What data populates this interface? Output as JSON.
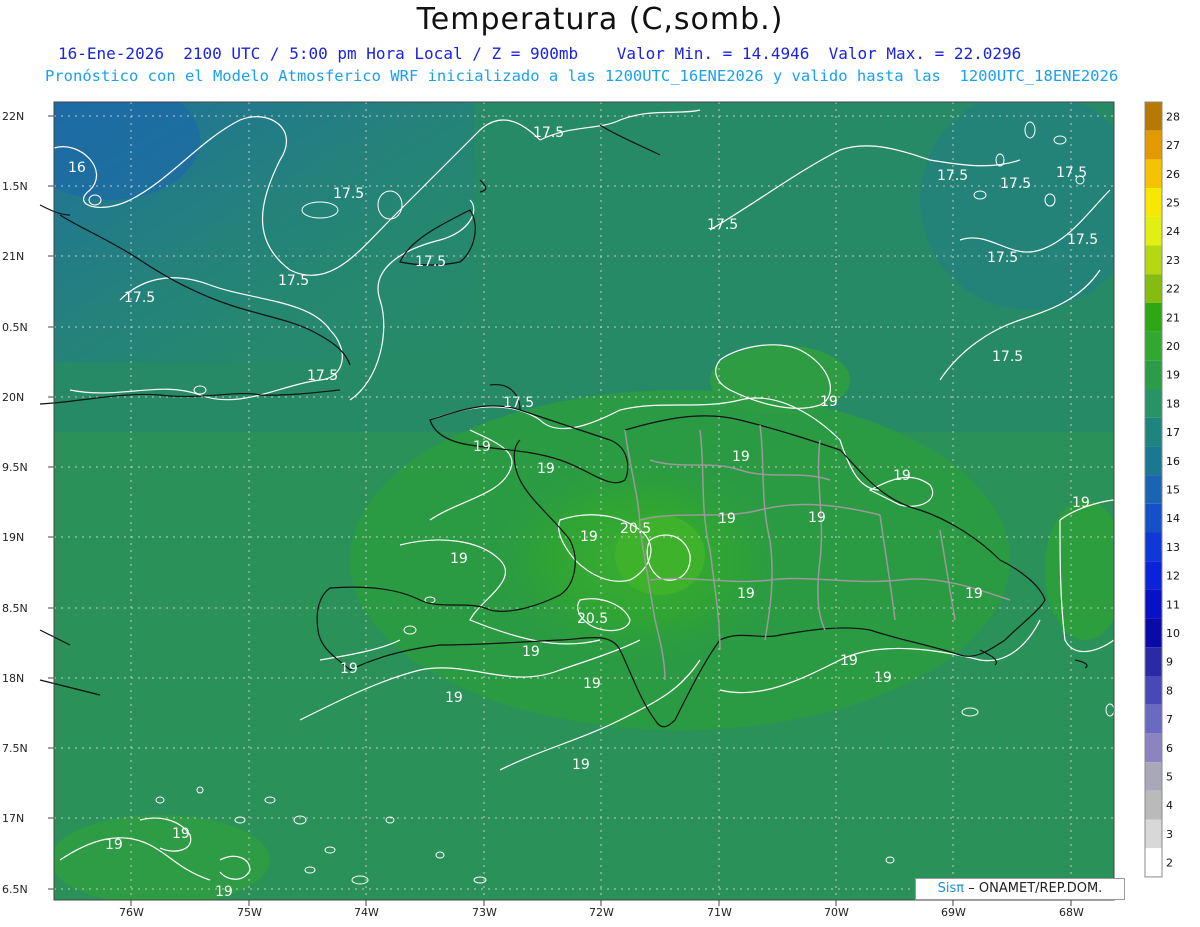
{
  "title": "Temperatura (C,somb.)",
  "subtitle_line1": "16-Ene-2026  2100 UTC / 5:00 pm Hora Local / Z = 900mb    Valor Min. = 14.4946  Valor Max. = 22.0296",
  "subtitle_line2": "Pronóstico con el Modelo Atmosferico WRF inicializado a las 1200UTC_16ENE2026 y valido hasta las  1200UTC_18ENE2026",
  "credit_brand": "Sisπ",
  "credit_text": "– ONAMET/REP.DOM.",
  "lat_labels": [
    "22N",
    "1.5N",
    "21N",
    "0.5N",
    "20N",
    "9.5N",
    "19N",
    "8.5N",
    "18N",
    "7.5N",
    "17N",
    "6.5N"
  ],
  "lon_labels": [
    "76W",
    "75W",
    "74W",
    "73W",
    "72W",
    "71W",
    "70W",
    "69W",
    "68W"
  ],
  "colorbar": {
    "labels": [
      "28",
      "27",
      "26",
      "25",
      "24",
      "23",
      "22",
      "21",
      "20",
      "19",
      "18",
      "17",
      "16",
      "15",
      "14",
      "13",
      "12",
      "11",
      "10",
      "9",
      "8",
      "7",
      "6",
      "5",
      "4",
      "3",
      "2"
    ],
    "colors": [
      "#b77a00",
      "#e39a00",
      "#f4c400",
      "#f6e800",
      "#e2ef12",
      "#b6d812",
      "#86bb10",
      "#2fa614",
      "#32a830",
      "#2d9c48",
      "#279466",
      "#1e8480",
      "#1a7890",
      "#1a64b4",
      "#1450c8",
      "#1037d8",
      "#0c22d8",
      "#0a10c6",
      "#0a0aa8",
      "#2a2aa6",
      "#4848b6",
      "#6a6ac0",
      "#8c84c0",
      "#a8a8b8",
      "#bababa",
      "#d8d8d8",
      "#ffffff"
    ]
  },
  "contour_labels": [
    "17.5",
    "16",
    "17.5",
    "17.5",
    "17.5",
    "17.5",
    "17.5",
    "17.5",
    "17.5",
    "17.5",
    "17.5",
    "17.5",
    "17.5",
    "17.5",
    "19",
    "19",
    "19",
    "19",
    "19",
    "19",
    "19",
    "19",
    "19",
    "19",
    "19",
    "19",
    "19",
    "19",
    "19",
    "19",
    "19",
    "19",
    "20.5",
    "20.5"
  ]
}
